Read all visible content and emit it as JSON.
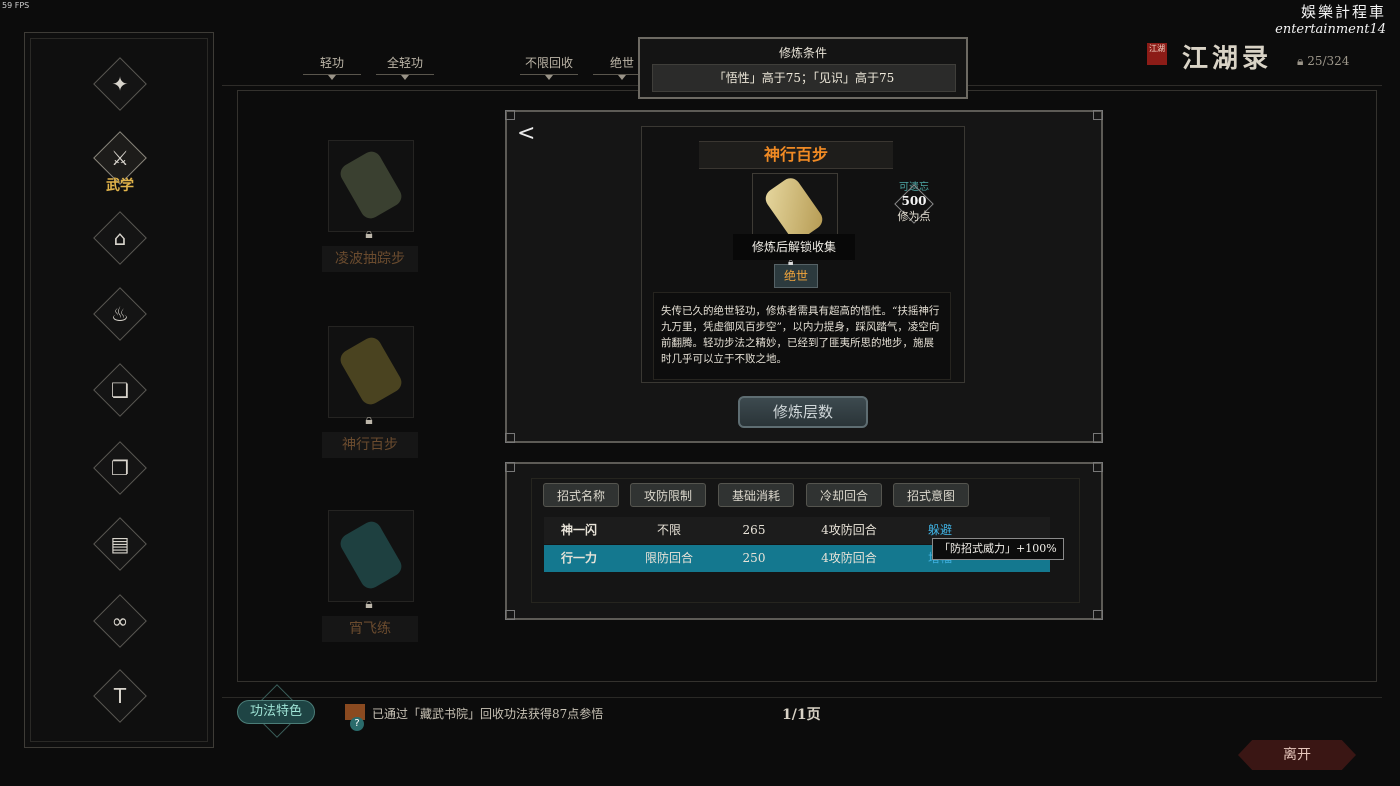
{
  "fps": "59 FPS",
  "watermark": {
    "line1": "娛樂計程車",
    "line2": "entertainment14"
  },
  "sidebar": {
    "items": [
      {
        "icon": "bug-icon",
        "glyph": "✦"
      },
      {
        "icon": "martial-arts-icon",
        "glyph": "⚔",
        "label": "武学",
        "active": true
      },
      {
        "icon": "building-icon",
        "glyph": "⌂"
      },
      {
        "icon": "bowl-icon",
        "glyph": "♨"
      },
      {
        "icon": "book-icon",
        "glyph": "❏"
      },
      {
        "icon": "scroll-icon",
        "glyph": "❐"
      },
      {
        "icon": "cards-icon",
        "glyph": "▤"
      },
      {
        "icon": "rope-icon",
        "glyph": "∞"
      },
      {
        "icon": "robe-icon",
        "glyph": "T"
      }
    ]
  },
  "filters": [
    "轻功",
    "全轻功",
    "不限回收",
    "绝世"
  ],
  "requirement": {
    "title": "修炼条件",
    "text": "「悟性」高于75；「见识」高于75"
  },
  "header": {
    "seal": "江湖",
    "title": "江湖录",
    "count": "25/324"
  },
  "skill_list": [
    {
      "name": "凌波抽踪步",
      "color": "#3a4030"
    },
    {
      "name": "神行百步",
      "color": "#4a4320"
    },
    {
      "name": "宵飞练",
      "color": "#1e4040"
    }
  ],
  "detail": {
    "back": "<",
    "name": "神行百步",
    "unlock_text": "修炼后解锁收集",
    "tier": "绝世",
    "forget_label": "可遗忘",
    "forget_value": "500",
    "forget_unit": "修为点",
    "description": "失传已久的绝世轻功，修炼者需具有超高的悟性。“扶摇神行九万里，凭虚御风百步空”，以内力提身，踩风踏气，凌空向前翻腾。轻功步法之精妙，已经到了匪夷所思的地步，施展时几乎可以立于不败之地。",
    "train_button": "修炼层数"
  },
  "moves": {
    "headers": [
      "招式名称",
      "攻防限制",
      "基础消耗",
      "冷却回合",
      "招式意图"
    ],
    "rows": [
      {
        "name": "神一闪",
        "limit": "不限",
        "cost": "265",
        "cooldown": "4攻防回合",
        "intent": "躲避"
      },
      {
        "name": "行一力",
        "limit": "限防回合",
        "cost": "250",
        "cooldown": "4攻防回合",
        "intent": "增幅"
      }
    ],
    "tooltip": "「防招式威力」+100%"
  },
  "footer": {
    "feature_button": "功法特色",
    "notice": "已通过「藏武书院」回收功法获得87点参悟",
    "page": "1/1页",
    "leave_button": "离开"
  }
}
